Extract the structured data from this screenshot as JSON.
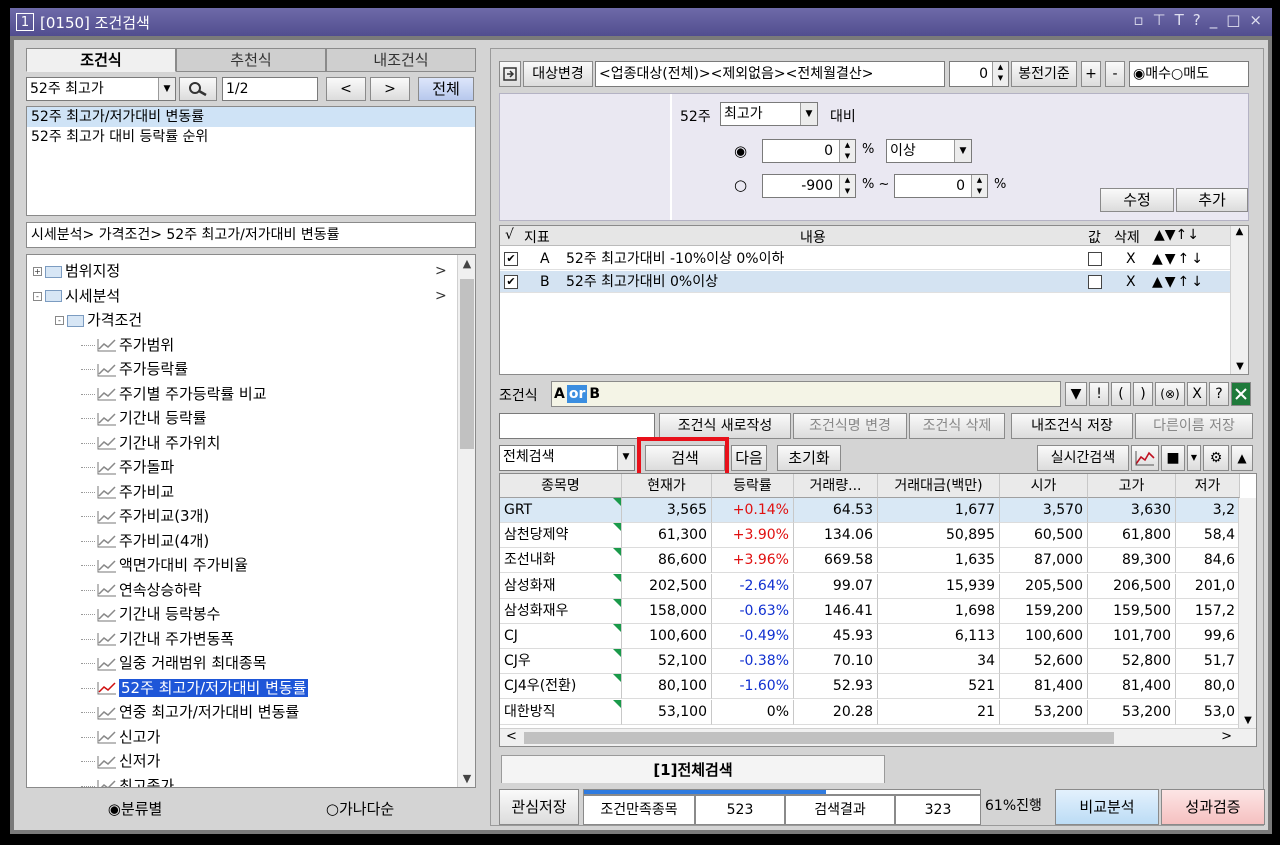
{
  "window": {
    "number": "1",
    "title": "[0150] 조건검색",
    "controls": [
      "▫",
      "⊤",
      "T",
      "?",
      "_",
      "□",
      "×"
    ]
  },
  "left": {
    "tabs": [
      {
        "label": "조건식",
        "active": true
      },
      {
        "label": "추천식",
        "active": false
      },
      {
        "label": "내조건식",
        "active": false
      }
    ],
    "search": {
      "combo_value": "52주 최고가",
      "page": "1/2",
      "prev": "<",
      "next": ">",
      "all": "전체"
    },
    "conditions": [
      {
        "label": "52주 최고가/저가대비 변동률",
        "selected": true
      },
      {
        "label": "52주 최고가 대비 등락률 순위",
        "selected": false
      }
    ],
    "path": "시세분석> 가격조건> 52주 최고가/저가대비 변동률",
    "tree": [
      {
        "label": "범위지정",
        "type": "folder",
        "level": 0,
        "expander": "+",
        "chevron": ">"
      },
      {
        "label": "시세분석",
        "type": "folder",
        "level": 0,
        "expander": "-",
        "chevron": ">"
      },
      {
        "label": "가격조건",
        "type": "folder",
        "level": 1,
        "expander": "-"
      },
      {
        "label": "주가범위",
        "type": "leaf",
        "level": 2
      },
      {
        "label": "주가등락률",
        "type": "leaf",
        "level": 2
      },
      {
        "label": "주기별 주가등락률 비교",
        "type": "leaf",
        "level": 2
      },
      {
        "label": "기간내 등락률",
        "type": "leaf",
        "level": 2
      },
      {
        "label": "기간내 주가위치",
        "type": "leaf",
        "level": 2
      },
      {
        "label": "주가돌파",
        "type": "leaf",
        "level": 2
      },
      {
        "label": "주가비교",
        "type": "leaf",
        "level": 2
      },
      {
        "label": "주가비교(3개)",
        "type": "leaf",
        "level": 2
      },
      {
        "label": "주가비교(4개)",
        "type": "leaf",
        "level": 2
      },
      {
        "label": "액면가대비 주가비율",
        "type": "leaf",
        "level": 2
      },
      {
        "label": "연속상승하락",
        "type": "leaf",
        "level": 2
      },
      {
        "label": "기간내 등락봉수",
        "type": "leaf",
        "level": 2
      },
      {
        "label": "기간내 주가변동폭",
        "type": "leaf",
        "level": 2
      },
      {
        "label": "일중 거래범위 최대종목",
        "type": "leaf",
        "level": 2
      },
      {
        "label": "52주 최고가/저가대비 변동률",
        "type": "leaf",
        "level": 2,
        "selected": true
      },
      {
        "label": "연중 최고가/저가대비 변동률",
        "type": "leaf",
        "level": 2
      },
      {
        "label": "신고가",
        "type": "leaf",
        "level": 2
      },
      {
        "label": "신저가",
        "type": "leaf",
        "level": 2
      },
      {
        "label": "최고종가",
        "type": "leaf",
        "level": 2
      }
    ],
    "radio": [
      {
        "label": "분류별",
        "checked": true
      },
      {
        "label": "가나다순",
        "checked": false
      }
    ]
  },
  "right": {
    "header": {
      "target_btn": "대상변경",
      "target_text": "<업종대상(전체)><제외없음><전체월결산>",
      "offset": "0",
      "bong_btn": "봉전기준",
      "plus": "+",
      "minus": "-",
      "buy": "매수",
      "sell": "매도",
      "buy_checked": true
    },
    "params": {
      "prefix": "52주",
      "combo": "최고가",
      "suffix": "대비",
      "row1": {
        "value": "0",
        "unit": "%",
        "op": "이상",
        "checked": true
      },
      "row2": {
        "from": "-900",
        "unit1": "% ~",
        "to": "0",
        "unit2": "%",
        "checked": false
      },
      "modify": "수정",
      "add": "추가"
    },
    "cond_table": {
      "headers": {
        "check": "√",
        "idx": "지표",
        "content": "내용",
        "value": "값",
        "delete": "삭제",
        "arrows": "▲▼↑↓"
      },
      "rows": [
        {
          "checked": true,
          "idx": "A",
          "content": "52주 최고가대비 -10%이상 0%이하",
          "delete": "X",
          "arrows": "▲▼↑↓",
          "selected": false
        },
        {
          "checked": true,
          "idx": "B",
          "content": "52주 최고가대비 0%이상",
          "delete": "X",
          "arrows": "▲▼↑↓",
          "selected": true
        }
      ]
    },
    "formula": {
      "label": "조건식",
      "tokens": [
        "A",
        "or",
        "B"
      ],
      "btns": [
        "▼",
        "!",
        "(",
        ")",
        "(⊗)",
        "X",
        "?"
      ]
    },
    "actions": {
      "new": "조건식 새로작성",
      "rename": "조건식명 변경",
      "delete": "조건식 삭제",
      "save": "내조건식 저장",
      "save_as": "다른이름 저장"
    },
    "search_bar": {
      "scope": "전체검색",
      "search": "검색",
      "next": "다음",
      "reset": "초기화",
      "realtime": "실시간검색"
    },
    "result_headers": [
      "종목명",
      "현재가",
      "등락률",
      "거래량...",
      "거래대금(백만)",
      "시가",
      "고가",
      "저가"
    ],
    "results": [
      {
        "name": "GRT",
        "price": "3,565",
        "rate": "+0.14%",
        "dir": "up",
        "vol": "64.53",
        "amt": "1,677",
        "open": "3,570",
        "high": "3,630",
        "low": "3,2",
        "sel": true
      },
      {
        "name": "삼천당제약",
        "price": "61,300",
        "rate": "+3.90%",
        "dir": "up",
        "vol": "134.06",
        "amt": "50,895",
        "open": "60,500",
        "high": "61,800",
        "low": "58,4"
      },
      {
        "name": "조선내화",
        "price": "86,600",
        "rate": "+3.96%",
        "dir": "up",
        "vol": "669.58",
        "amt": "1,635",
        "open": "87,000",
        "high": "89,300",
        "low": "84,6"
      },
      {
        "name": "삼성화재",
        "price": "202,500",
        "rate": "-2.64%",
        "dir": "down",
        "vol": "99.07",
        "amt": "15,939",
        "open": "205,500",
        "high": "206,500",
        "low": "201,0"
      },
      {
        "name": "삼성화재우",
        "price": "158,000",
        "rate": "-0.63%",
        "dir": "down",
        "vol": "146.41",
        "amt": "1,698",
        "open": "159,200",
        "high": "159,500",
        "low": "157,2"
      },
      {
        "name": "CJ",
        "price": "100,600",
        "rate": "-0.49%",
        "dir": "down",
        "vol": "45.93",
        "amt": "6,113",
        "open": "100,600",
        "high": "101,700",
        "low": "99,6"
      },
      {
        "name": "CJ우",
        "price": "52,100",
        "rate": "-0.38%",
        "dir": "down",
        "vol": "70.10",
        "amt": "34",
        "open": "52,600",
        "high": "52,800",
        "low": "51,7"
      },
      {
        "name": "CJ4우(전환)",
        "price": "80,100",
        "rate": "-1.60%",
        "dir": "down",
        "vol": "52.93",
        "amt": "521",
        "open": "81,400",
        "high": "81,400",
        "low": "80,0"
      },
      {
        "name": "대한방직",
        "price": "53,100",
        "rate": "0%",
        "dir": "flat",
        "vol": "20.28",
        "amt": "21",
        "open": "53,200",
        "high": "53,200",
        "low": "53,0"
      }
    ],
    "bottom_tab": "[1]전체검색",
    "status": {
      "fav_save": "관심저장",
      "match_label": "조건만족종목",
      "match_count": "523",
      "result_label": "검색결과",
      "result_count": "323",
      "progress_text": "61%진행",
      "progress": 0.61,
      "compare": "비교분석",
      "verify": "성과검증"
    }
  }
}
